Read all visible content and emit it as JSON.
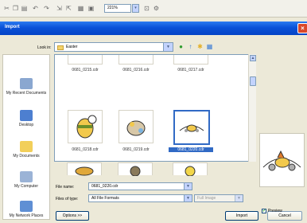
{
  "toolbar": {
    "zoom_value": "221%",
    "zoom_arrow": "▾"
  },
  "dialog": {
    "title": "Import",
    "close_glyph": "×",
    "look_in_label": "Look in:",
    "look_in_value": "Easter",
    "places": [
      {
        "label": "My Recent Documents",
        "icon": "recent-documents-icon",
        "color": "#8aa7d0"
      },
      {
        "label": "Desktop",
        "icon": "desktop-icon",
        "color": "#4d7fd0"
      },
      {
        "label": "My Documents",
        "icon": "my-documents-icon",
        "color": "#f2cf5a"
      },
      {
        "label": "My Computer",
        "icon": "my-computer-icon",
        "color": "#9bb3d6"
      },
      {
        "label": "My Network Places",
        "icon": "network-places-icon",
        "color": "#5f8fd4"
      }
    ],
    "files": [
      {
        "name": "0681_0215.cdr"
      },
      {
        "name": "0681_0216.cdr"
      },
      {
        "name": "0681_0217.cdr"
      },
      {
        "name": "0681_0218.cdr"
      },
      {
        "name": "0681_0219.cdr"
      },
      {
        "name": "0681_0220.cdr",
        "selected": true
      },
      {
        "name": ""
      },
      {
        "name": ""
      },
      {
        "name": ""
      }
    ],
    "file_name_label": "File name:",
    "file_name_value": "0681_0220.cdr",
    "files_of_type_label": "Files of type:",
    "files_of_type_value": "All File Formats",
    "full_image_value": "Full Image",
    "options_label": "Options >>",
    "import_label": "Import",
    "cancel_label": "Cancel",
    "preview_label": "Preview"
  },
  "colors": {
    "titlebar": "#0a52d8",
    "selection": "#316ac5"
  }
}
